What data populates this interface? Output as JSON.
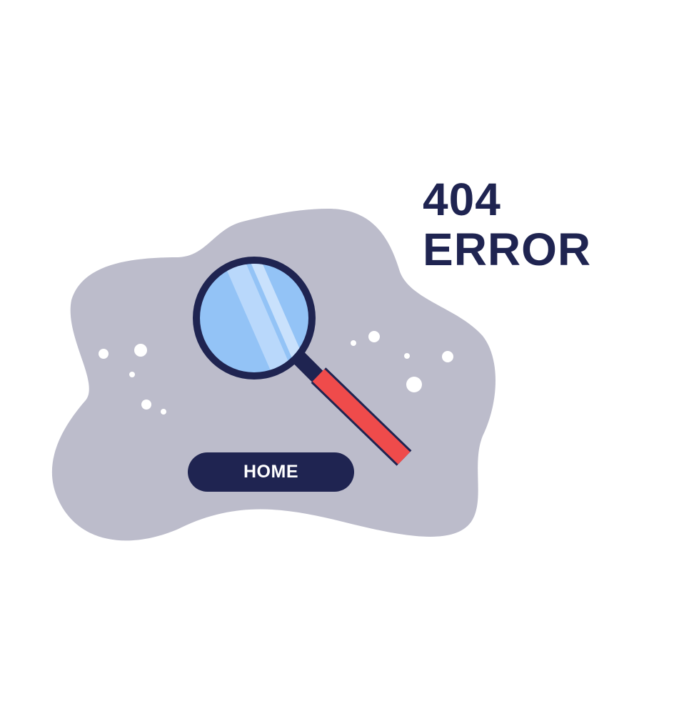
{
  "error": {
    "code": "404",
    "label": "ERROR"
  },
  "home_button": {
    "label": "HOME"
  },
  "illustration": {
    "blob_color": "#bcbccb",
    "lens_fill": "#93c3f6",
    "lens_rim": "#1f2451",
    "handle_color": "#ef4b4b",
    "sparkle_color": "#ffffff"
  },
  "colors": {
    "text": "#1f2451",
    "button_bg": "#1f2451",
    "button_text": "#ffffff",
    "background": "#ffffff"
  }
}
